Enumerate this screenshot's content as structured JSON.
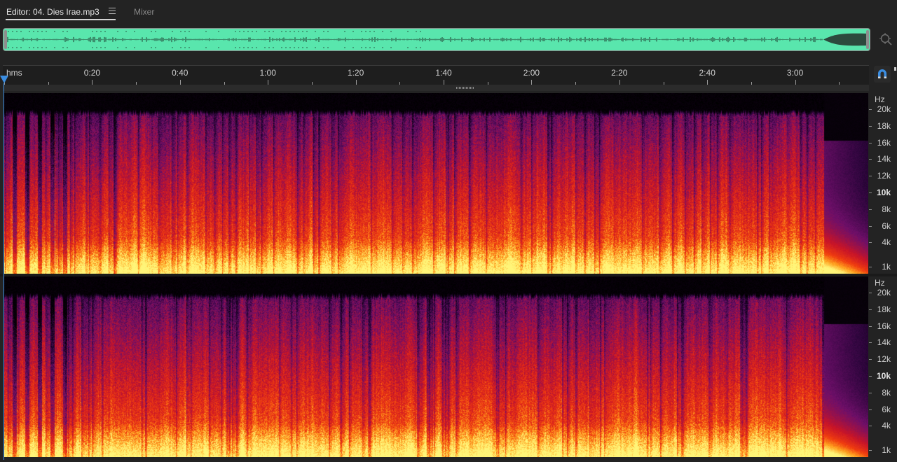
{
  "tabs": {
    "editor_label": "Editor: 04. Dies Irae.mp3",
    "mixer_label": "Mixer"
  },
  "ruler": {
    "unit": "hms",
    "labels": [
      "0:20",
      "0:40",
      "1:00",
      "1:20",
      "1:40",
      "2:00",
      "2:20",
      "2:40",
      "3:00"
    ]
  },
  "frequency_axis": {
    "unit": "Hz",
    "labels": [
      {
        "text": "20k",
        "khz": 20
      },
      {
        "text": "18k",
        "khz": 18
      },
      {
        "text": "16k",
        "khz": 16
      },
      {
        "text": "14k",
        "khz": 14
      },
      {
        "text": "12k",
        "khz": 12
      },
      {
        "text": "10k",
        "khz": 10,
        "bold": true
      },
      {
        "text": "8k",
        "khz": 8
      },
      {
        "text": "6k",
        "khz": 6
      },
      {
        "text": "4k",
        "khz": 4
      },
      {
        "text": "1k",
        "khz": 1
      }
    ]
  },
  "channels": [
    "left",
    "right"
  ],
  "icons": {
    "tab_menu": "hamburger-menu-icon",
    "zoom": "zoom-target-icon",
    "snap": "magnet-snap-icon"
  },
  "colors": {
    "waveform_fill": "#59e6ad",
    "playhead": "#3b8de0",
    "spectro_low": "#ffe96a",
    "spectro_mid": "#e8201a",
    "spectro_high": "#5a1570"
  }
}
